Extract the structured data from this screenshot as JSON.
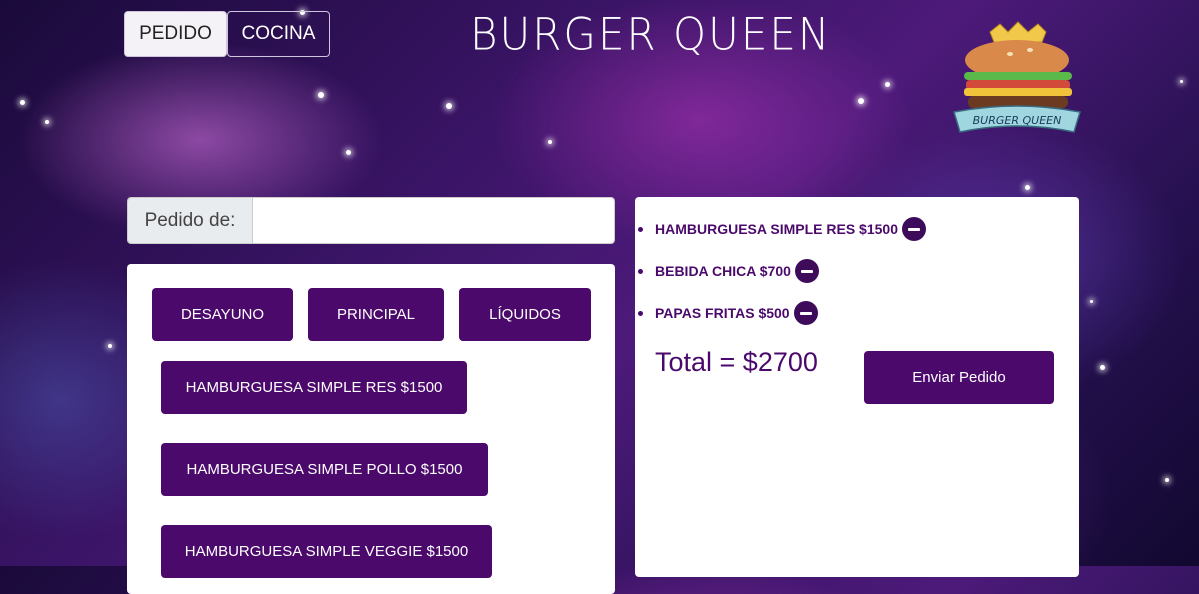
{
  "nav": {
    "tabs": [
      {
        "label": "PEDIDO",
        "active": true
      },
      {
        "label": "COCINA",
        "active": false
      }
    ]
  },
  "header": {
    "title": "BURGER QUEEN",
    "logo_text": "BURGER QUEEN"
  },
  "order_form": {
    "label": "Pedido de:",
    "value": "",
    "placeholder": ""
  },
  "menu": {
    "categories": [
      "DESAYUNO",
      "PRINCIPAL",
      "LÍQUIDOS"
    ],
    "items": [
      "HAMBURGUESA SIMPLE RES $1500",
      "HAMBURGUESA SIMPLE POLLO $1500",
      "HAMBURGUESA SIMPLE VEGGIE $1500"
    ]
  },
  "order": {
    "items": [
      "HAMBURGUESA SIMPLE RES $1500",
      "BEBIDA CHICA $700",
      "PAPAS FRITAS $500"
    ],
    "total": "Total  =  $2700",
    "send_label": "Enviar Pedido"
  },
  "colors": {
    "accent": "#4b0a6b",
    "panel": "#ffffff"
  }
}
